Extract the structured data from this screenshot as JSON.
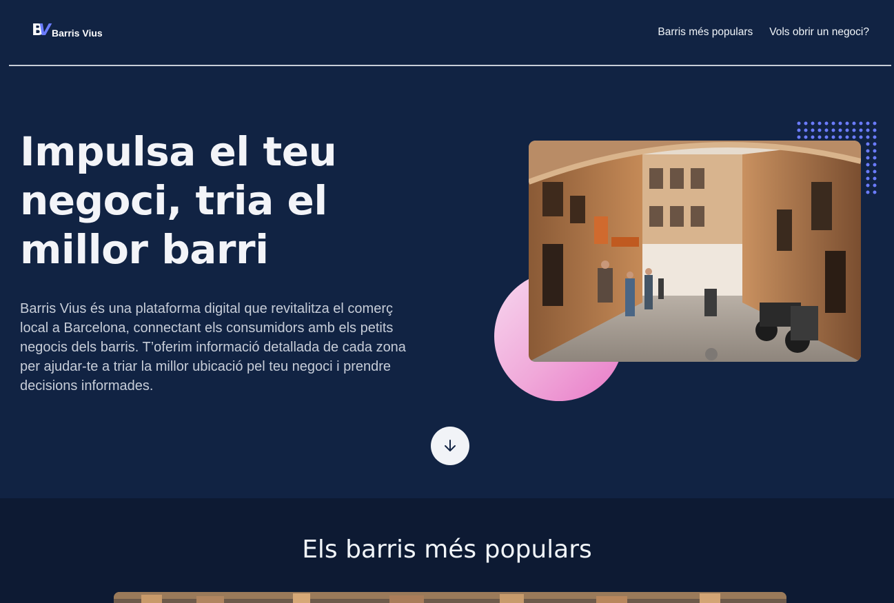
{
  "header": {
    "logo_text": "Barris Vius",
    "logo_mark_b": "B",
    "logo_mark_v": "V",
    "nav": [
      {
        "label": "Barris més populars"
      },
      {
        "label": "Vols obrir un negoci?"
      }
    ]
  },
  "hero": {
    "title": "Impulsa el teu negoci, tria el millor barri",
    "description": "Barris Vius és una plataforma digital que revitalitza el comerç local a Barcelona, connectant els consumidors amb els petits negocis dels barris. T’oferim informació detallada de cada zona per ajudar-te a triar la millor ubicació pel teu negoci i prendre decisions informades.",
    "scroll_icon": "arrow-down-icon"
  },
  "popular": {
    "title": "Els barris més populars"
  },
  "colors": {
    "background": "#112343",
    "section_background": "#0d1a33",
    "accent": "#6b7cff",
    "pink": "#e879c7"
  }
}
